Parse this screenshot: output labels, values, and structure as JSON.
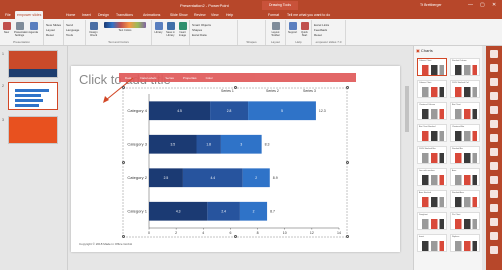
{
  "window": {
    "title": "Presentation2 - PowerPoint",
    "context_tab": "Drawing Tools",
    "user": "Tt Brettberger",
    "controls": [
      "—",
      "▢",
      "✕"
    ]
  },
  "ribbon_tabs": [
    "File",
    "empower slides",
    "Home",
    "Insert",
    "Design",
    "Transitions",
    "Animations",
    "Slide Show",
    "Review",
    "View",
    "Help",
    "Format",
    "Tell me what you want to do"
  ],
  "active_tab": "empower slides",
  "ribbon": {
    "groups": [
      {
        "label": "Presentation",
        "buttons": [
          "New",
          "Presentation Settings",
          "Agenda"
        ]
      },
      {
        "label": "",
        "buttons": [
          "New Slides",
          "Layout",
          "Reset"
        ]
      },
      {
        "label": "",
        "buttons": [
          "Send",
          "Language",
          "Tools"
        ]
      },
      {
        "label": "Text and Colors",
        "buttons": [
          "Design Check",
          "Text Colors"
        ]
      },
      {
        "label": "",
        "buttons": [
          "Library",
          "Save in Library",
          "Insert Image"
        ]
      },
      {
        "label": "",
        "buttons": [
          "Smart Objects",
          "Shapes",
          "Excel Data"
        ]
      },
      {
        "label": "Shapes",
        "buttons": []
      },
      {
        "label": "Layout",
        "buttons": [
          "Layout Toolbar"
        ]
      },
      {
        "label": "Help",
        "buttons": [
          "Support",
          "Quick Start"
        ]
      },
      {
        "label": "empower slides 7.0",
        "buttons": [
          "Excel Links",
          "Feedback",
          "Reset"
        ]
      }
    ]
  },
  "thumbnails": [
    {
      "num": "1"
    },
    {
      "num": "2"
    },
    {
      "num": "3"
    }
  ],
  "slide": {
    "title_placeholder": "Click to add title",
    "footer": "Copyright © 2018 Made in Office GmbH",
    "chart_toolbar": [
      "Data",
      "Data Labels",
      "Series",
      "Properties",
      "Color"
    ]
  },
  "chart_data": {
    "type": "bar",
    "orientation": "horizontal",
    "stacked": true,
    "categories": [
      "Category 1",
      "Category 2",
      "Category 3",
      "Category 4"
    ],
    "series": [
      {
        "name": "Series 1",
        "values": [
          4.3,
          2.5,
          3.5,
          4.5
        ],
        "color": "#1b3a73"
      },
      {
        "name": "Series 2",
        "values": [
          2.4,
          4.4,
          1.8,
          2.8
        ],
        "color": "#27549e"
      },
      {
        "name": "Series 3",
        "values": [
          2,
          2,
          3,
          5
        ],
        "color": "#2f73c8"
      }
    ],
    "totals": [
      "8.7",
      "8.9",
      "8.3",
      "12.3"
    ],
    "xlim": [
      0,
      14
    ],
    "xticks": [
      "0",
      "2",
      "4",
      "6",
      "8",
      "10",
      "12",
      "14"
    ],
    "legend": "top"
  },
  "charts_pane": {
    "title": "Charts",
    "items": [
      "Column Chart",
      "Stacked Column",
      "Column Chart",
      "100% Stacked Col.",
      "Clustered Column",
      "Bar Chart",
      "Bar Chart Stacked",
      "Clustered Bar",
      "100% Stacked Bar",
      "Stacked Bar",
      "Line with markers",
      "Area",
      "Area Stacked",
      "Stacked Area",
      "Doughnut",
      "Pie Chart",
      "Insert",
      "Replace"
    ]
  },
  "colors": {
    "accent": "#b7472a",
    "selection": "#d24726",
    "chart_toolbar": "#e05a5a"
  }
}
